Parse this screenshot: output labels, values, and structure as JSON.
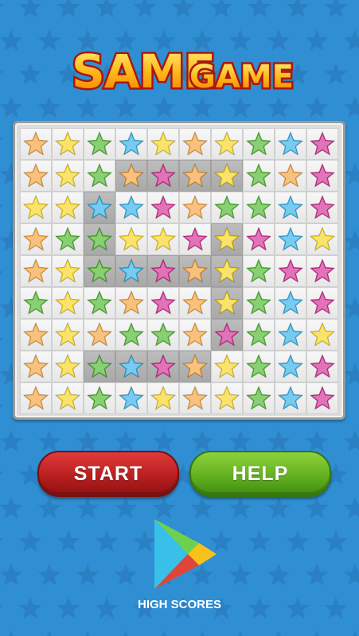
{
  "title": {
    "word1": "SAME",
    "word2": "GAME"
  },
  "colors": {
    "background": "#2f8fd2",
    "star_orange": "#f5a23a",
    "star_yellow": "#f7d51f",
    "star_green": "#4bb52a",
    "star_blue": "#2fb0e8",
    "star_magenta": "#d02a8f"
  },
  "board": {
    "rows": [
      [
        "orange",
        "yellow",
        "green",
        "blue",
        "yellow",
        "orange",
        "yellow",
        "green",
        "blue",
        "magenta"
      ],
      [
        "orange",
        "yellow",
        "green",
        "orange",
        "magenta",
        "orange",
        "yellow",
        "green",
        "orange",
        "magenta"
      ],
      [
        "yellow",
        "yellow",
        "blue",
        "blue",
        "magenta",
        "orange",
        "green",
        "green",
        "blue",
        "magenta"
      ],
      [
        "orange",
        "green",
        "green",
        "yellow",
        "yellow",
        "magenta",
        "yellow",
        "magenta",
        "blue",
        "yellow"
      ],
      [
        "orange",
        "yellow",
        "green",
        "blue",
        "magenta",
        "orange",
        "yellow",
        "green",
        "magenta",
        "magenta"
      ],
      [
        "green",
        "yellow",
        "green",
        "orange",
        "magenta",
        "orange",
        "yellow",
        "green",
        "blue",
        "magenta"
      ],
      [
        "orange",
        "yellow",
        "orange",
        "green",
        "green",
        "orange",
        "magenta",
        "green",
        "blue",
        "yellow"
      ],
      [
        "orange",
        "yellow",
        "green",
        "blue",
        "magenta",
        "orange",
        "yellow",
        "green",
        "blue",
        "magenta"
      ],
      [
        "orange",
        "yellow",
        "green",
        "blue",
        "yellow",
        "orange",
        "yellow",
        "green",
        "blue",
        "magenta"
      ]
    ],
    "selected": [
      [
        1,
        3
      ],
      [
        1,
        4
      ],
      [
        1,
        5
      ],
      [
        1,
        6
      ],
      [
        2,
        2
      ],
      [
        3,
        2
      ],
      [
        4,
        2
      ],
      [
        4,
        3
      ],
      [
        4,
        4
      ],
      [
        4,
        5
      ],
      [
        4,
        6
      ],
      [
        3,
        6
      ],
      [
        5,
        6
      ],
      [
        6,
        6
      ],
      [
        7,
        2
      ],
      [
        7,
        3
      ],
      [
        7,
        4
      ],
      [
        7,
        5
      ]
    ]
  },
  "buttons": {
    "start": "START",
    "help": "HELP"
  },
  "high_scores": {
    "label": "HIGH SCORES",
    "icon": "google-play-icon"
  }
}
